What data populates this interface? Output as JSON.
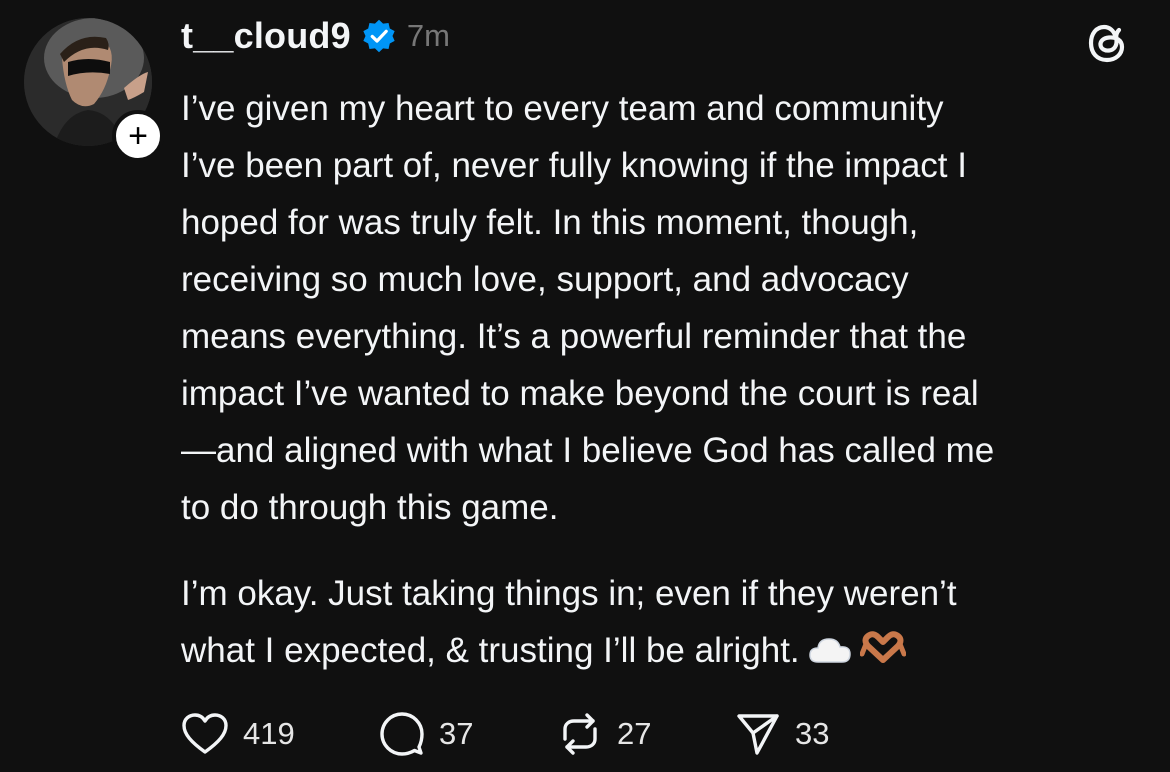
{
  "post": {
    "username": "t__cloud9",
    "verified": true,
    "timestamp": "7m",
    "paragraph1": "I’ve given my heart to every team and community\nI’ve been part of, never fully knowing if the impact I\nhoped for was truly felt. In this moment, though,\nreceiving so much love, support, and advocacy\nmeans everything. It’s a powerful reminder that the\nimpact I’ve wanted to make beyond the court is real\n—and aligned with what I believe God has called me\nto do through this game.",
    "paragraph2": "I’m okay. Just taking things in; even if they weren’t\nwhat I expected, & trusting I’ll be alright.",
    "emojis": [
      "cloud-emoji",
      "heart-hands-emoji"
    ]
  },
  "actions": {
    "likes": "419",
    "replies": "37",
    "reposts": "27",
    "shares": "33"
  },
  "colors": {
    "background": "#101010",
    "text": "#f3f5f7",
    "muted": "#777777",
    "verified": "#0095f6"
  }
}
